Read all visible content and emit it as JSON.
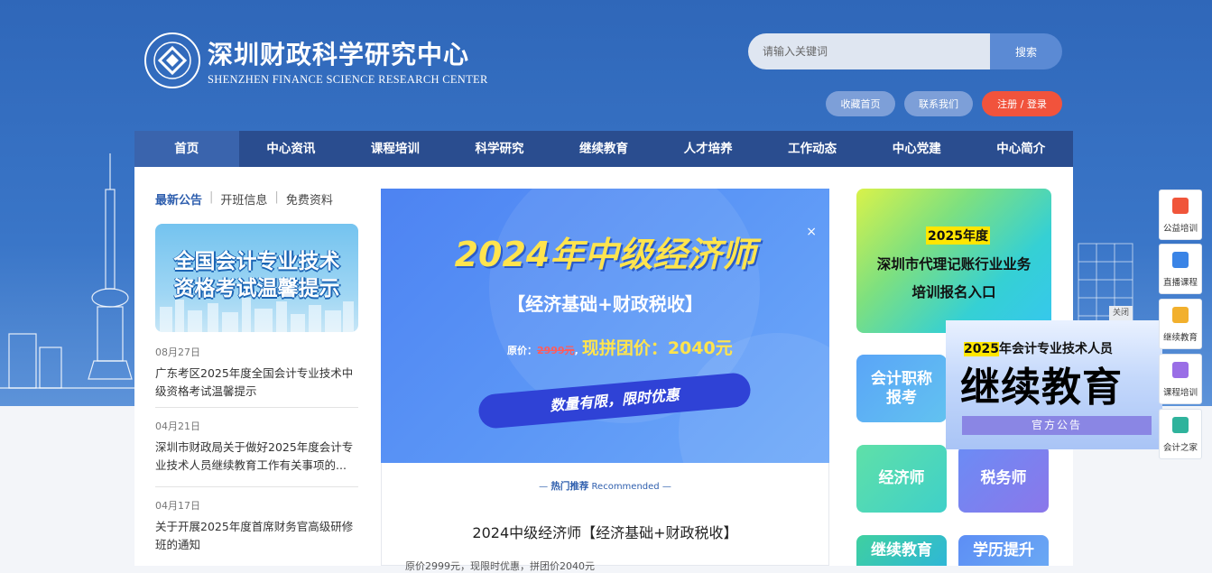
{
  "logo": {
    "cn": "深圳财政科学研究中心",
    "en": "SHENZHEN FINANCE SCIENCE RESEARCH CENTER"
  },
  "search": {
    "placeholder": "请输入关键词",
    "button": "搜索"
  },
  "top_buttons": {
    "bookmark": "收藏首页",
    "contact": "联系我们",
    "login": "注册 / 登录"
  },
  "nav": [
    "首页",
    "中心资讯",
    "课程培训",
    "科学研究",
    "继续教育",
    "人才培养",
    "工作动态",
    "中心党建",
    "中心简介"
  ],
  "tabs": [
    "最新公告",
    "开班信息",
    "免费资料"
  ],
  "notice_banner": {
    "line1": "全国会计专业技术",
    "line2": "资格考试温馨提示"
  },
  "news": [
    {
      "date": "08月27日",
      "title": "广东考区2025年度全国会计专业技术中级资格考试温馨提示"
    },
    {
      "date": "04月21日",
      "title": "深圳市财政局关于做好2025年度会计专业技术人员继续教育工作有关事项的..."
    },
    {
      "date": "04月17日",
      "title": "关于开展2025年度首席财务官高级研修班的通知"
    }
  ],
  "promo": {
    "title": "2024年中级经济师",
    "subtitle": "【经济基础+财政税收】",
    "price_label": "原价：",
    "old_price": "2999元",
    "new_price": "现拼团价：2040元",
    "pill": "数量有限，限时优惠",
    "close": "×"
  },
  "recommended": {
    "cn": "热门推荐",
    "en": "Recommended",
    "title": "2024中级经济师【经济基础+财政税收】",
    "extra": "原价2999元，现限时优惠，拼团价2040元"
  },
  "tiles": {
    "big": {
      "year": "2025年度",
      "line1": "深圳市代理记账行业业务",
      "line2": "培训报名入口"
    },
    "accounting_title": "会计职称\n报考",
    "economist": "经济师",
    "tax": "税务师",
    "continuing": "继续教育",
    "more": "学历提升"
  },
  "float_ad": {
    "year": "2025",
    "line1_rest": "年会计专业技术人员",
    "line2": "继续教育",
    "line3": "官方公告",
    "close": "关闭"
  },
  "side_menu": [
    {
      "label": "公益培训",
      "color": "#f0553a"
    },
    {
      "label": "直播课程",
      "color": "#3a84e6"
    },
    {
      "label": "继续教育",
      "color": "#f2b02d"
    },
    {
      "label": "课程培训",
      "color": "#9a6ee6"
    },
    {
      "label": "会计之家",
      "color": "#2fb39c"
    }
  ]
}
